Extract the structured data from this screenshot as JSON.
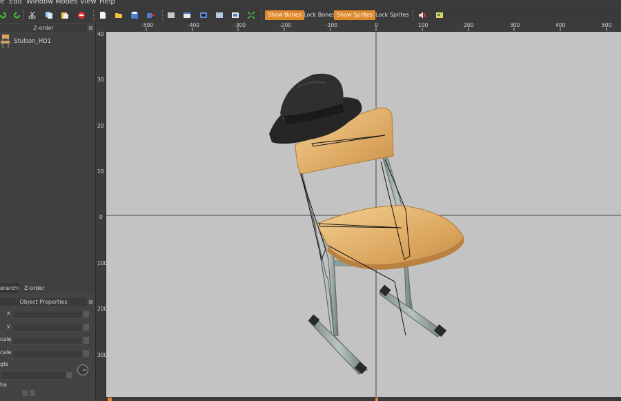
{
  "menu": {
    "items": [
      "e",
      "Edit",
      "Window",
      "Modes",
      "View",
      "Help"
    ]
  },
  "toolbar": {
    "icons": [
      "redo-icon",
      "undo-icon",
      "cut-icon",
      "copy-icon",
      "paste-icon",
      "stop-icon",
      "new-file-icon",
      "open-folder-icon",
      "save-icon",
      "export-icon",
      "view-icon-1",
      "view-icon-2",
      "view-icon-3",
      "view-icon-4",
      "view-icon-5",
      "fit-view-icon",
      "mute-sound-icon",
      "image-icon"
    ],
    "show_bones": "Show Bones",
    "lock_bones": "Lock Bones",
    "show_sprites": "Show Sprites",
    "lock_sprites": "Lock Sprites",
    "accent": "#e08a2e"
  },
  "zorder_panel": {
    "title": "Z-order",
    "item_label": "Stulson_HD1"
  },
  "tabs": {
    "hierarchy": "erarchy",
    "zorder": "Z-order"
  },
  "props_panel": {
    "title": "Object Properties",
    "x_label": "x",
    "y_label": "y",
    "xscale_label": "cale",
    "yscale_label": "cale",
    "angle_label": "gle",
    "alpha_label": "ha"
  },
  "rulers": {
    "top_ticks": [
      "-500",
      "-400",
      "-300",
      "-200",
      "-100",
      "0",
      "100",
      "200",
      "300",
      "400",
      "500"
    ],
    "left_ticks": [
      "40",
      "30",
      "20",
      "10",
      "0",
      "100",
      "200",
      "300"
    ]
  },
  "canvas": {
    "background": "#c3c3c3"
  }
}
